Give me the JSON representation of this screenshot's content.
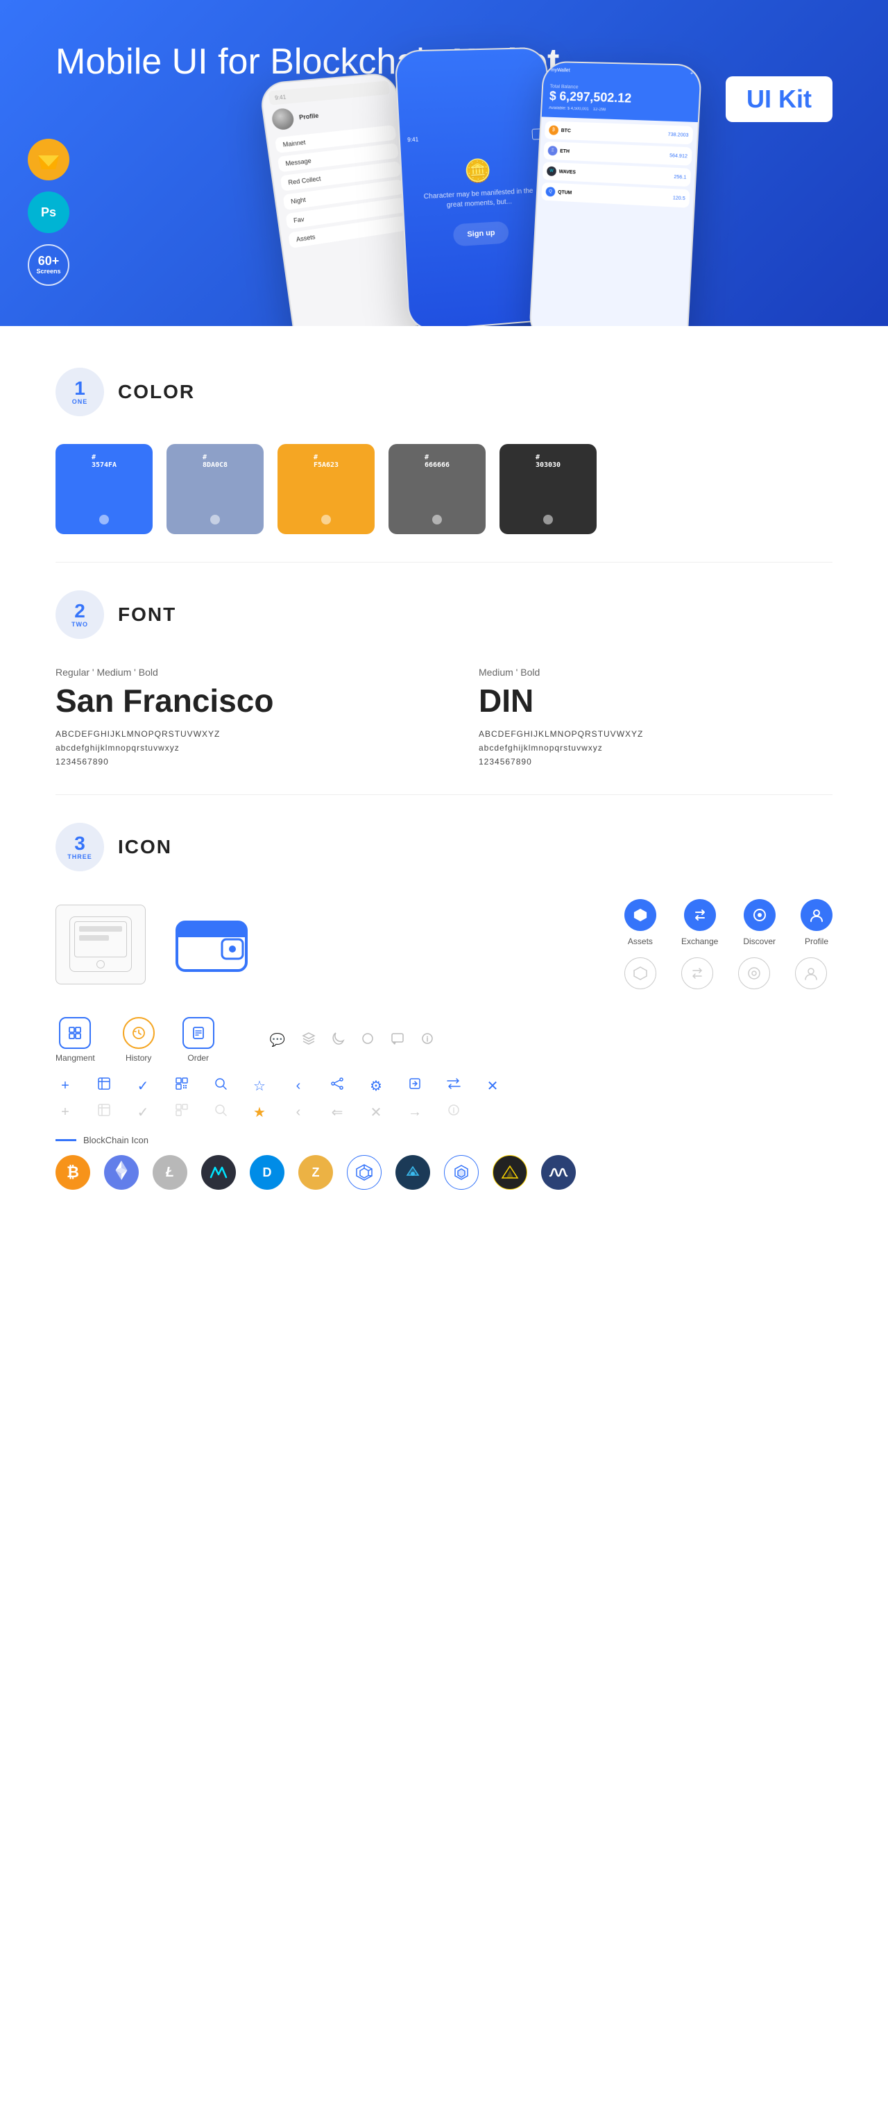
{
  "hero": {
    "title_normal": "Mobile UI for Blockchain ",
    "title_bold": "Wallet",
    "badge": "UI Kit",
    "badges": [
      {
        "id": "sketch",
        "symbol": "◇",
        "style": "sketch",
        "label": "Sketch"
      },
      {
        "id": "ps",
        "symbol": "Ps",
        "style": "ps",
        "label": "Photoshop"
      },
      {
        "id": "screens",
        "count": "60+",
        "label": "Screens"
      }
    ]
  },
  "sections": {
    "color": {
      "number": "1",
      "word": "ONE",
      "title": "COLOR",
      "swatches": [
        {
          "hex": "#3574FA",
          "code": "#\n3574FA",
          "dot": true
        },
        {
          "hex": "#8DA0C8",
          "code": "#\n8DA0C8",
          "dot": true
        },
        {
          "hex": "#F5A623",
          "code": "#\nF5A623",
          "dot": true
        },
        {
          "hex": "#666666",
          "code": "#\n666666",
          "dot": true
        },
        {
          "hex": "#303030",
          "code": "#\n303030",
          "dot": true
        }
      ]
    },
    "font": {
      "number": "2",
      "word": "TWO",
      "title": "FONT",
      "fonts": [
        {
          "styles": "Regular ' Medium ' Bold",
          "name": "San Francisco",
          "uppercase": "ABCDEFGHIJKLMNOPQRSTUVWXYZ",
          "lowercase": "abcdefghijklmnopqrstuvwxyz",
          "numbers": "1234567890",
          "variant": "sf"
        },
        {
          "styles": "Medium ' Bold",
          "name": "DIN",
          "uppercase": "ABCDEFGHIJKLMNOPQRSTUVWXYZ",
          "lowercase": "abcdefghijklmnopqrstuvwxyz",
          "numbers": "1234567890",
          "variant": "din"
        }
      ]
    },
    "icon": {
      "number": "3",
      "word": "THREE",
      "title": "ICON",
      "nav_icons": [
        {
          "label": "Assets",
          "symbol": "◆",
          "color": "#3574FA"
        },
        {
          "label": "Exchange",
          "symbol": "⇌",
          "color": "#3574FA"
        },
        {
          "label": "Discover",
          "symbol": "⊙",
          "color": "#3574FA"
        },
        {
          "label": "Profile",
          "symbol": "⌂",
          "color": "#3574FA"
        }
      ],
      "mgmt_icons": [
        {
          "label": "Mangment",
          "type": "rect"
        },
        {
          "label": "History",
          "type": "clock"
        },
        {
          "label": "Order",
          "type": "list"
        }
      ],
      "misc_icons": [
        "✦",
        "⊡",
        "✓",
        "⊞",
        "⌕",
        "☆",
        "‹",
        "⇐",
        "⚙",
        "⬚",
        "⇆",
        "✕"
      ],
      "misc_icons_grey": [
        "✦",
        "⊡",
        "✓",
        "⊞",
        "⌕",
        "☆",
        "‹",
        "⇐",
        "⊗",
        "→",
        "✕"
      ],
      "blockchain_label": "BlockChain Icon",
      "crypto_icons": [
        {
          "symbol": "₿",
          "bg": "#F7931A",
          "color": "#fff",
          "name": "BTC"
        },
        {
          "symbol": "Ξ",
          "bg": "#627EEA",
          "color": "#fff",
          "name": "ETH"
        },
        {
          "symbol": "Ł",
          "bg": "#B8B8B8",
          "color": "#fff",
          "name": "LTC"
        },
        {
          "symbol": "◈",
          "bg": "#2C2F3B",
          "color": "#00E5FF",
          "name": "WAVES"
        },
        {
          "symbol": "D",
          "bg": "#008CE7",
          "color": "#fff",
          "name": "DASH"
        },
        {
          "symbol": "Z",
          "bg": "#ECB244",
          "color": "#fff",
          "name": "ZEC"
        },
        {
          "symbol": "⬡",
          "bg": "#fff",
          "color": "#3574FA",
          "name": "GRID",
          "border": "#3574FA"
        },
        {
          "symbol": "▲",
          "bg": "#1B3A57",
          "color": "#3ABBEF",
          "name": "ARK"
        },
        {
          "symbol": "◈",
          "bg": "#fff",
          "color": "#3574FA",
          "name": "OMG",
          "border": "#3574FA"
        },
        {
          "symbol": "⬡",
          "bg": "#000",
          "color": "#FFD700",
          "name": "BAT"
        },
        {
          "symbol": "〜",
          "bg": "#2B4175",
          "color": "#fff",
          "name": "WAVES2"
        }
      ]
    }
  }
}
